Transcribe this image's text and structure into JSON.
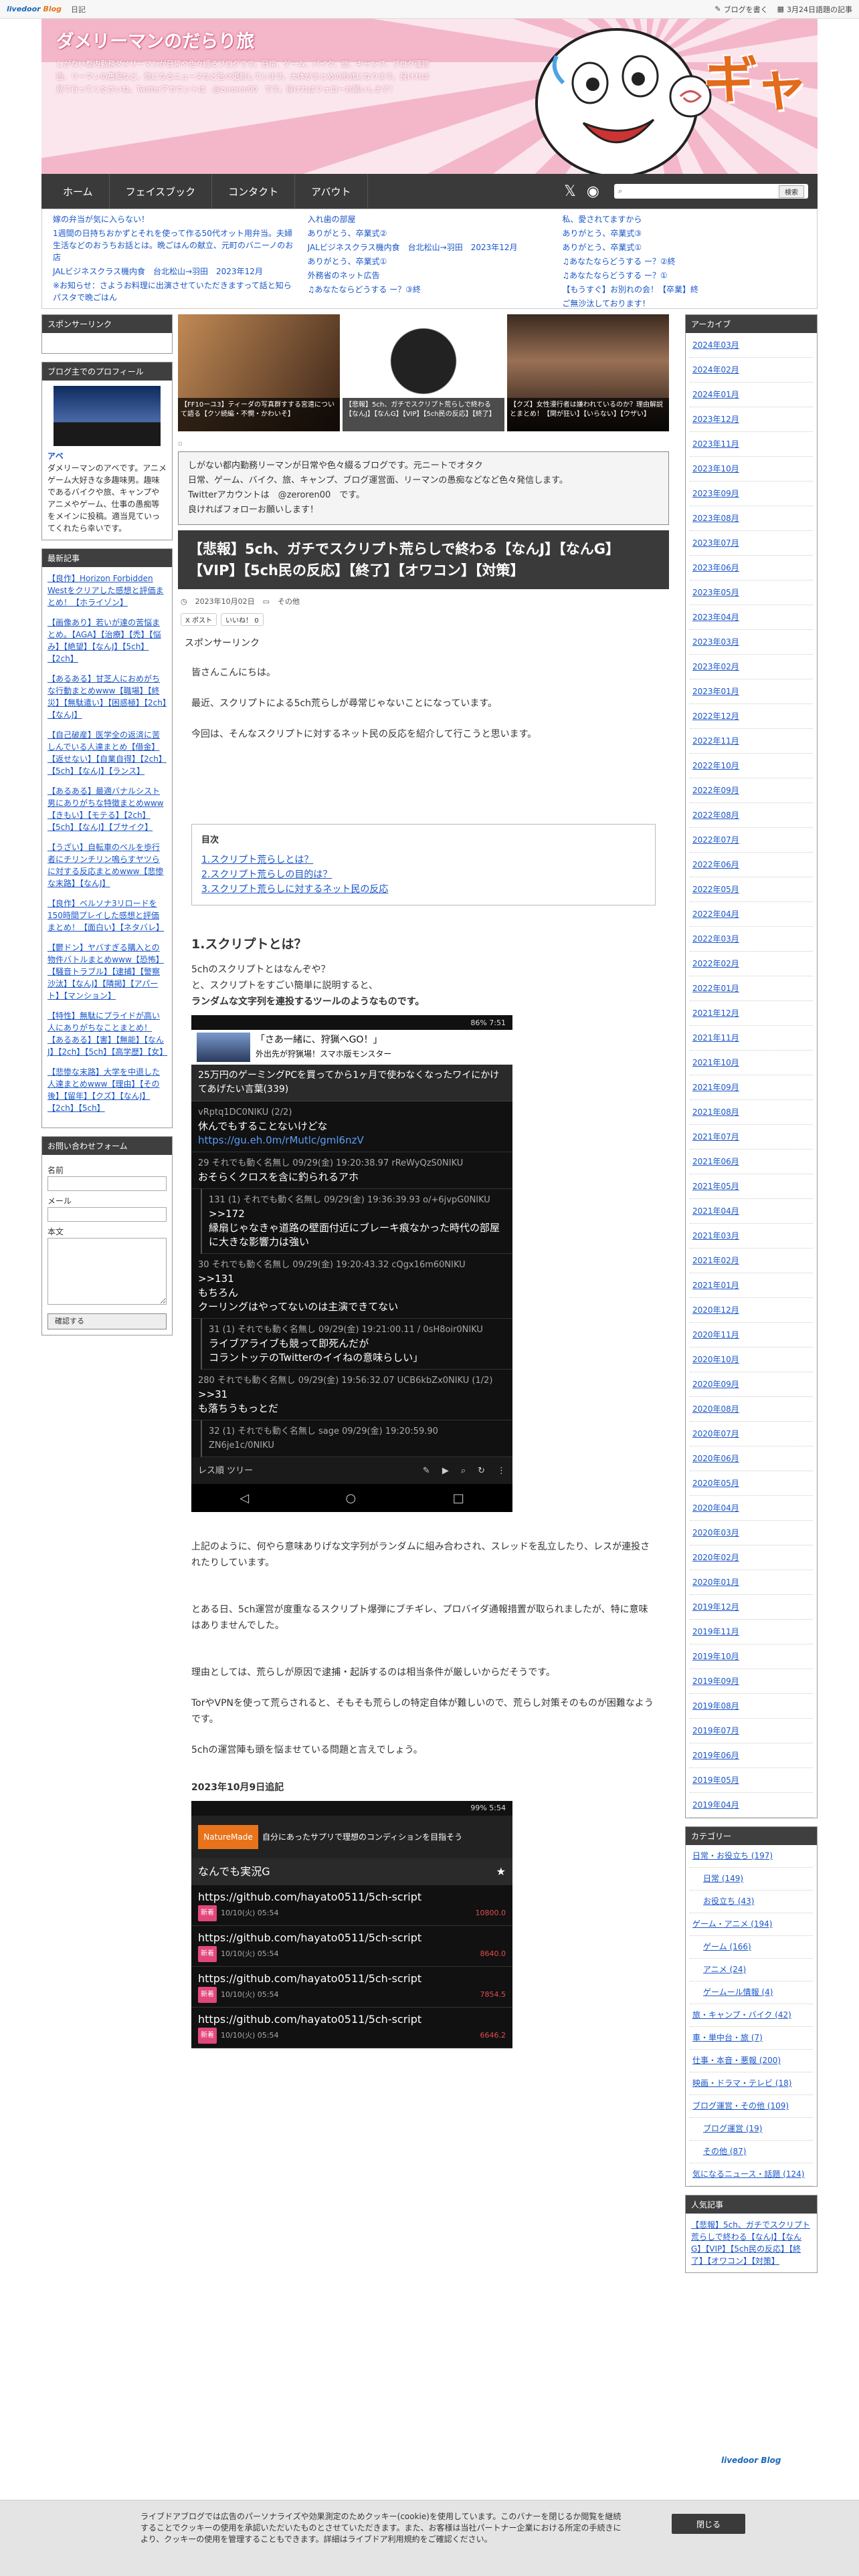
{
  "topbar": {
    "brand": "livedoor",
    "brand2": "Blog",
    "tab": "日記",
    "write": "ブログを書く",
    "date": "3月24日語題の記事"
  },
  "header": {
    "title": "ダメリーマンのだらり旅",
    "desc": "しがない都内勤務ダメリーマンが日常や色々綴るブログです。日常、ゲーム、バイク、旅、キャンプ、ブログ運営面、リーマンの愚痴など、気になるニュースなど色々更新しています。大体がまとめの形式になります。良ければ見て行ってくださいね。Twitterアカウントは　@zeroren00　です。良ければフォローお願いします！",
    "gya": "ギャ"
  },
  "nav": {
    "items": [
      "ホーム",
      "フェイスブック",
      "コンタクト",
      "アバウト"
    ],
    "search_btn": "検索"
  },
  "newsbar": {
    "col1": [
      "嫁の弁当が気に入らない！",
      "1週間の日持ちおかずとそれを使って作る50代オット用弁当。夫婦生活などのおうちお話とは。晩ごはんの献立、元町のバニーノのお店",
      "JALビジネスクラス機内食　台北松山→羽田　2023年12月",
      "※お知らせ：さようお料理に出演させていただきますって話と知らパスタで晩ごはん"
    ],
    "col2": [
      "入れ歯の部屋",
      "ありがとう、卒業式②",
      "JALビジネスクラス機内食　台北松山→羽田　2023年12月",
      "ありがとう、卒業式①",
      "外務省のネット広告",
      "♫あなたならどうする ー？③終"
    ],
    "col3": [
      "私、愛されてますから",
      "ありがとう、卒業式③",
      "ありがとう、卒業式①",
      "♫あなたならどうする ー？②終",
      "♫あなたならどうする ー？①",
      "【もうすぐ】お別れの会！【卒業】終",
      "ご無沙汰しております！"
    ]
  },
  "left": {
    "sponsor_title": "スポンサーリンク",
    "profile_title": "ブログ主でのプロフィール",
    "profile_name": "アベ",
    "profile_text": "ダメリーマンのアベです。アニメゲーム大好きな多趣味男。趣味であるバイクや旅、キャンプやアニメやゲーム、仕事の愚痴等をメインに投稿。適当見ていってくれたら幸いです。",
    "latest_title": "最新記事",
    "latest": [
      "【良作】Horizon Forbidden Westをクリアした感想と評価まとめ！【ホライゾン】",
      "【画像あり】若いが達の苦悩まとめ。【AGA】【治療】【禿】【悩み】【絶望】【なんJ】【5ch】【2ch】",
      "【あるある】甘芝人におめがちな行動まとめwww【職場】【終災】【無駄遣い】【困惑極】【2ch】【なんJ】",
      "【自己破産】医学全の返済に苦しんでいる人達まとめ【借金】【返せない】【自業自得】【2ch】【5ch】【なんJ】【ランス】",
      "【あるある】最適バナルシスト男にありがちな特徴まとめwww【きもい】【モテる】【2ch】【5ch】【なんJ】【ブサイク】",
      "【うざい】自転車のベルを歩行者にチリンチリン鳴らすヤツらに対する反応まとめwww【悲惨な末路】【なんJ】",
      "【良作】ベルソナ3リロードを150時間プレイした感想と評価まとめ！【面白い】【ネタバレ】",
      "【鬱ドン】ヤバすぎる購入との物件バトルまとめwww【恐怖】【騒音トラブル】【逮捕】【警察沙汰】【なんJ】【隣掲】【アパート】【マンション】",
      "【特性】無駄にプライドが高い人にありがちなことまとめ！【あるある】【害】【無能】【なんJ】【2ch】【5ch】【高学歴】【女】",
      "【悲惨な末路】大学を中退した人達まとめwww【理由】【その後】【留年】【クズ】【なんJ】【2ch】【5ch】"
    ],
    "form_title": "お問い合わせフォーム",
    "form_name": "名前",
    "form_mail": "メール",
    "form_body": "本文",
    "form_btn": "確認する"
  },
  "main": {
    "thumbs": [
      "【FF10ーユ3】ティーダの写真群すする宮遠について語る【クソ続編・不憫・かわいそ】",
      "【悲報】5ch、ガチでスクリプト荒らしで終わる【なんJ】【なんG】【VIP】【5ch民の反応】【終了】",
      "【クズ】女性漫行者は嫌われているのか？理由解説とまとめ！【関が狂い】【いらない】【ウザい】"
    ],
    "intro": [
      "しがない都内勤務リーマンが日常や色々綴るブログです。元ニートでオタク",
      "日常、ゲーム、バイク、旅、キャンプ、ブログ運営面、リーマンの愚痴などなど色々発信します。",
      "Twitterアカウントは　@zeroren00　です。",
      "良ければフォローお願いします！"
    ],
    "title": "【悲報】5ch、ガチでスクリプト荒らしで終わる【なんJ】【なんG】【VIP】【5ch民の反応】【終了】【オワコン】【対策】",
    "date": "2023年10月02日",
    "category": "その他",
    "share1": "X ポスト",
    "share2": "いいね！ 0",
    "sponsor": "スポンサーリンク",
    "p1": "皆さんこんにちは。",
    "p2": "最近、スクリプトによる5ch荒らしが尋常じゃないことになっています。",
    "p3": "今回は、そんなスクリプトに対するネット民の反応を紹介して行こうと思います。",
    "toc_title": "目次",
    "toc": [
      "1.スクリプト荒らしとは？",
      "2.スクリプト荒らしの目的は？",
      "3.スクリプト荒らしに対するネット民の反応"
    ],
    "h2": "1.スクリプトとは？",
    "p4": "5chのスクリプトとはなんぞや？",
    "p5": "と、スクリプトをすごい簡単に説明すると、",
    "p6": "ランダムな文字列を連投するツールのようなものです。",
    "shot": {
      "status": "86% 7:51",
      "ad_line1": "「さあ一緒に、狩猟へGO！」",
      "ad_line2": "外出先が狩猟場！スマホ版モンスター",
      "thread": "25万円のゲーミングPCを買ってから1ヶ月で使わなくなったワイにかけてあげたい言葉(339)",
      "res": [
        {
          "h": "vRptq1DC0NIKU (2/2)",
          "body": "休んでもすることないけどな",
          "link": "https://gu.eh.0m/rMutlc/gml6nzV"
        },
        {
          "h": "29 それでも動く名無し 09/29(金) 19:20:38.97 rReWyQzS0NIKU",
          "body": "おそらくクロスを含に釣られるアホ"
        },
        {
          "h": "131 (1) それでも動く名無し 09/29(金) 19:36:39.93 o/+6jvpG0NIKU",
          "body": ">>172\n縁扇じゃなきゃ道路の壁面付近にブレーキ痕なかった時代の部屋に大きな影響力は強い"
        },
        {
          "h": "30 それでも動く名無し 09/29(金) 19:20:43.32 cQgx16m60NIKU",
          "body": ">>131\nもちろん\nクーリングはやってないのは主演できてない"
        },
        {
          "h": "31 (1) それでも動く名無し 09/29(金) 19:21:00.11 / 0sH8oir0NIKU",
          "body": "ライブアライブも競って即死んだが\nコラントッテのTwitterのイイねの意味らしい」"
        },
        {
          "h": "280 それでも動く名無し 09/29(金) 19:56:32.07 UCB6kbZx0NIKU (1/2)",
          "body": ">>31\nも落ちうもっとだ"
        },
        {
          "h": "32 (1) それでも動く名無し sage 09/29(金) 19:20:59.90 ZN6je1c/0NIKU",
          "body": ""
        }
      ],
      "toolbar": "レス順 ツリー"
    },
    "p7": "上記のように、何やら意味ありげな文字列がランダムに組み合わされ、スレッドを乱立したり、レスが連投されたりしています。",
    "p8": "とある日、5ch運営が度重なるスクリプト爆弾にブチギレ、プロバイダ通報措置が取られましたが、特に意味はありませんでした。",
    "p9": "理由としては、荒らしが原因で逮捕・起訴するのは相当条件が厳しいからだそうです。",
    "p10": "TorやVPNを使って荒らされると、そもそも荒らしの特定自体が難しいので、荒らし対策そのものが困難なようです。",
    "p11": "5chの運営陣も頭を悩ませている問題と言えでしょう。",
    "update": "2023年10月9日追記",
    "shot2": {
      "status": "99% 5:54",
      "ad_brand": "NatureMade",
      "ad_text": "自分にあったサプリで理想のコンディションを目指そう",
      "header": "なんでも実況G",
      "links": [
        {
          "url": "https://github.com/hayato0511/5ch-script",
          "badge": "新着",
          "time": "10/10(火) 05:54",
          "rate": "10800.0"
        },
        {
          "url": "https://github.com/hayato0511/5ch-script",
          "badge": "新着",
          "time": "10/10(火) 05:54",
          "rate": "8640.0"
        },
        {
          "url": "https://github.com/hayato0511/5ch-script",
          "badge": "新着",
          "time": "10/10(火) 05:54",
          "rate": "7854.5"
        },
        {
          "url": "https://github.com/hayato0511/5ch-script",
          "badge": "新着",
          "time": "10/10(火) 05:54",
          "rate": "6646.2"
        }
      ]
    }
  },
  "right": {
    "archive_title": "アーカイブ",
    "archive": [
      "2024年03月",
      "2024年02月",
      "2024年01月",
      "2023年12月",
      "2023年11月",
      "2023年10月",
      "2023年09月",
      "2023年08月",
      "2023年07月",
      "2023年06月",
      "2023年05月",
      "2023年04月",
      "2023年03月",
      "2023年02月",
      "2023年01月",
      "2022年12月",
      "2022年11月",
      "2022年10月",
      "2022年09月",
      "2022年08月",
      "2022年07月",
      "2022年06月",
      "2022年05月",
      "2022年04月",
      "2022年03月",
      "2022年02月",
      "2022年01月",
      "2021年12月",
      "2021年11月",
      "2021年10月",
      "2021年09月",
      "2021年08月",
      "2021年07月",
      "2021年06月",
      "2021年05月",
      "2021年04月",
      "2021年03月",
      "2021年02月",
      "2021年01月",
      "2020年12月",
      "2020年11月",
      "2020年10月",
      "2020年09月",
      "2020年08月",
      "2020年07月",
      "2020年06月",
      "2020年05月",
      "2020年04月",
      "2020年03月",
      "2020年02月",
      "2020年01月",
      "2019年12月",
      "2019年11月",
      "2019年10月",
      "2019年09月",
      "2019年08月",
      "2019年07月",
      "2019年06月",
      "2019年05月",
      "2019年04月"
    ],
    "cat_title": "カテゴリー",
    "cats": [
      {
        "label": "日常・お役立ち (197)",
        "sub": false
      },
      {
        "label": "日常 (149)",
        "sub": true
      },
      {
        "label": "お役立ち (43)",
        "sub": true
      },
      {
        "label": "ゲーム・アニメ (194)",
        "sub": false
      },
      {
        "label": "ゲーム (166)",
        "sub": true
      },
      {
        "label": "アニメ (24)",
        "sub": true
      },
      {
        "label": "ゲームール情報 (4)",
        "sub": true
      },
      {
        "label": "旅・キャンプ・バイク (42)",
        "sub": false
      },
      {
        "label": "車・単中台・旅 (7)",
        "sub": false
      },
      {
        "label": "仕事・本音・悪報 (200)",
        "sub": false
      },
      {
        "label": "映画・ドラマ・テレビ (18)",
        "sub": false
      },
      {
        "label": "ブログ運営・その他 (109)",
        "sub": false
      },
      {
        "label": "ブログ運営 (19)",
        "sub": true
      },
      {
        "label": "その他 (87)",
        "sub": true
      },
      {
        "label": "気になるニュース・話題 (124)",
        "sub": false
      }
    ],
    "pop_title": "人気記事",
    "pop": "【悲報】5ch、ガチでスクリプト荒らしで終わる【なんJ】【なんG】【VIP】【5ch民の反応】【終了】【オワコン】【対策】"
  },
  "footer_brand": "livedoor Blog",
  "cookie": {
    "text": "ライブドアブログでは広告のパーソナライズや効果測定のためクッキー(cookie)を使用しています。このバナーを閉じるか閲覧を継続することでクッキーの使用を承認いただいたものとさせていただきます。また、お客様は当社パートナー企業における所定の手続きにより、クッキーの使用を管理することもできます。詳細はライブドア利用規約をご確認ください。",
    "btn": "閉じる"
  }
}
